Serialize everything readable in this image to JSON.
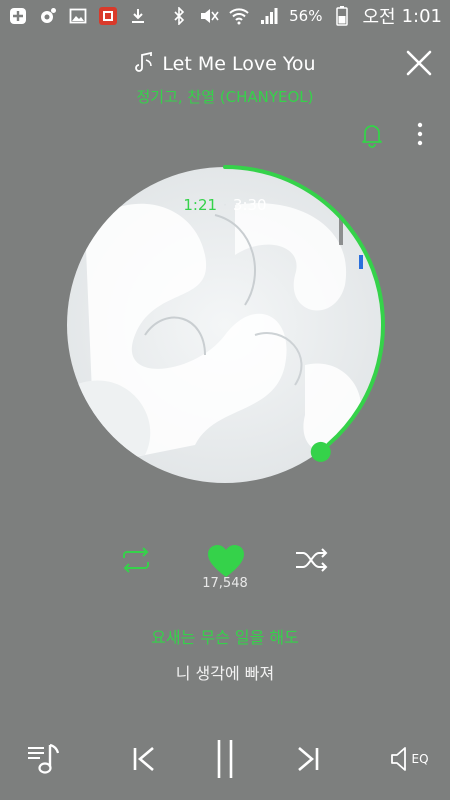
{
  "status_bar": {
    "battery": "56%",
    "time_prefix": "오전",
    "time": "1:01"
  },
  "player": {
    "song_title": "Let Me Love You",
    "artist": "정기고, 찬열 (CHANYEOL)",
    "elapsed": "1:21",
    "separator": "·",
    "total": "3:30",
    "progress_fraction": 0.386,
    "likes": "17,548",
    "lyric_current": "요새는 무슨 일을 해도",
    "lyric_next": "니 생각에 빠져",
    "eq_label": "EQ",
    "accent_color": "#35d24a",
    "background_color": "#7d7f7e"
  }
}
